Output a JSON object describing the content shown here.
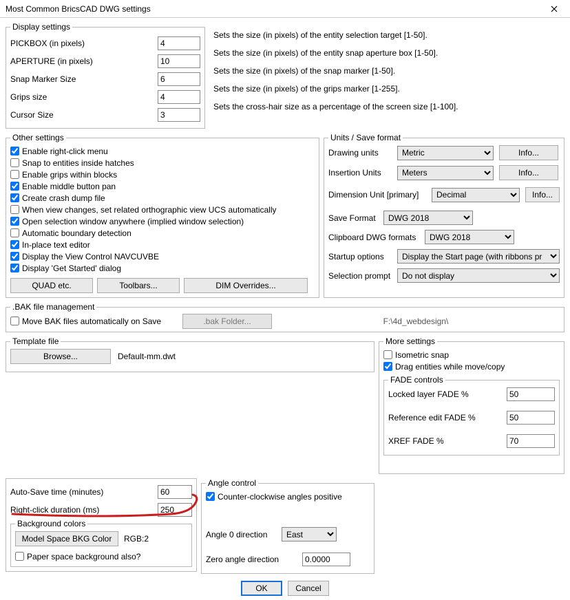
{
  "title": "Most Common BricsCAD DWG settings",
  "display": {
    "legend": "Display settings",
    "rows": [
      {
        "label": "PICKBOX (in pixels)",
        "value": "4",
        "desc": "Sets the size (in pixels) of the entity selection target [1-50]."
      },
      {
        "label": "APERTURE (in pixels)",
        "value": "10",
        "desc": "Sets the size (in pixels) of the entity snap aperture box [1-50]."
      },
      {
        "label": "Snap Marker Size",
        "value": "6",
        "desc": "Sets the size (in pixels) of the snap marker [1-50]."
      },
      {
        "label": "Grips size",
        "value": "4",
        "desc": "Sets the size (in pixels) of the grips marker [1-255]."
      },
      {
        "label": "Cursor Size",
        "value": "3",
        "desc": "Sets the cross-hair size as a percentage of the screen size [1-100]."
      }
    ]
  },
  "other": {
    "legend": "Other settings",
    "checks": [
      {
        "label": "Enable right-click menu",
        "checked": true
      },
      {
        "label": "Snap to entities inside hatches",
        "checked": false
      },
      {
        "label": "Enable grips within blocks",
        "checked": false
      },
      {
        "label": "Enable middle button pan",
        "checked": true
      },
      {
        "label": "Create crash dump file",
        "checked": true
      },
      {
        "label": "When view changes, set related orthographic view UCS automatically",
        "checked": false
      },
      {
        "label": "Open selection window anywhere (implied window selection)",
        "checked": true
      },
      {
        "label": "Automatic boundary detection",
        "checked": false
      },
      {
        "label": "In-place text editor",
        "checked": true
      },
      {
        "label": "Display the View Control NAVCUVBE",
        "checked": true
      },
      {
        "label": "Display 'Get Started' dialog",
        "checked": true
      }
    ],
    "btn_quad": "QUAD etc.",
    "btn_toolbars": "Toolbars...",
    "btn_dim": "DIM Overrides..."
  },
  "units": {
    "legend": "Units / Save format",
    "drawing_units_label": "Drawing units",
    "drawing_units": "Metric",
    "insertion_units_label": "Insertion Units",
    "insertion_units": "Meters",
    "dimension_unit_label": "Dimension Unit [primary]",
    "dimension_unit": "Decimal",
    "save_format_label": "Save Format",
    "save_format": "DWG 2018",
    "clipboard_label": "Clipboard DWG formats",
    "clipboard": "DWG 2018",
    "startup_label": "Startup options",
    "startup": "Display the Start page (with ribbons pr",
    "selection_label": "Selection prompt",
    "selection": "Do not display",
    "info": "Info..."
  },
  "bak": {
    "legend": ".BAK file management",
    "move_label": "Move BAK files automatically on Save",
    "move_checked": false,
    "folder_btn": ".bak Folder...",
    "path": "F:\\4d_webdesign\\"
  },
  "template": {
    "legend": "Template file",
    "browse": "Browse...",
    "file": "Default-mm.dwt"
  },
  "more": {
    "legend": "More settings",
    "iso_label": "Isometric snap",
    "iso_checked": false,
    "drag_label": "Drag entities while move/copy",
    "drag_checked": true,
    "fade_legend": "FADE controls",
    "locked_label": "Locked layer FADE %",
    "locked_val": "50",
    "refedit_label": "Reference edit FADE %",
    "refedit_val": "50",
    "xref_label": "XREF FADE %",
    "xref_val": "70"
  },
  "time": {
    "autosave_label": "Auto-Save time (minutes)",
    "autosave_val": "60",
    "rclick_label": "Right-click duration (ms)",
    "rclick_val": "250"
  },
  "bgcolors": {
    "legend": "Background colors",
    "btn": "Model Space BKG Color",
    "rgb": "RGB:2",
    "paper_label": "Paper space background also?",
    "paper_checked": false
  },
  "angle": {
    "legend": "Angle control",
    "ccw_label": "Counter-clockwise angles positive",
    "ccw_checked": true,
    "dir0_label": "Angle 0 direction",
    "dir0": "East",
    "zero_label": "Zero angle direction",
    "zero_val": "0.0000"
  },
  "buttons": {
    "ok": "OK",
    "cancel": "Cancel"
  }
}
